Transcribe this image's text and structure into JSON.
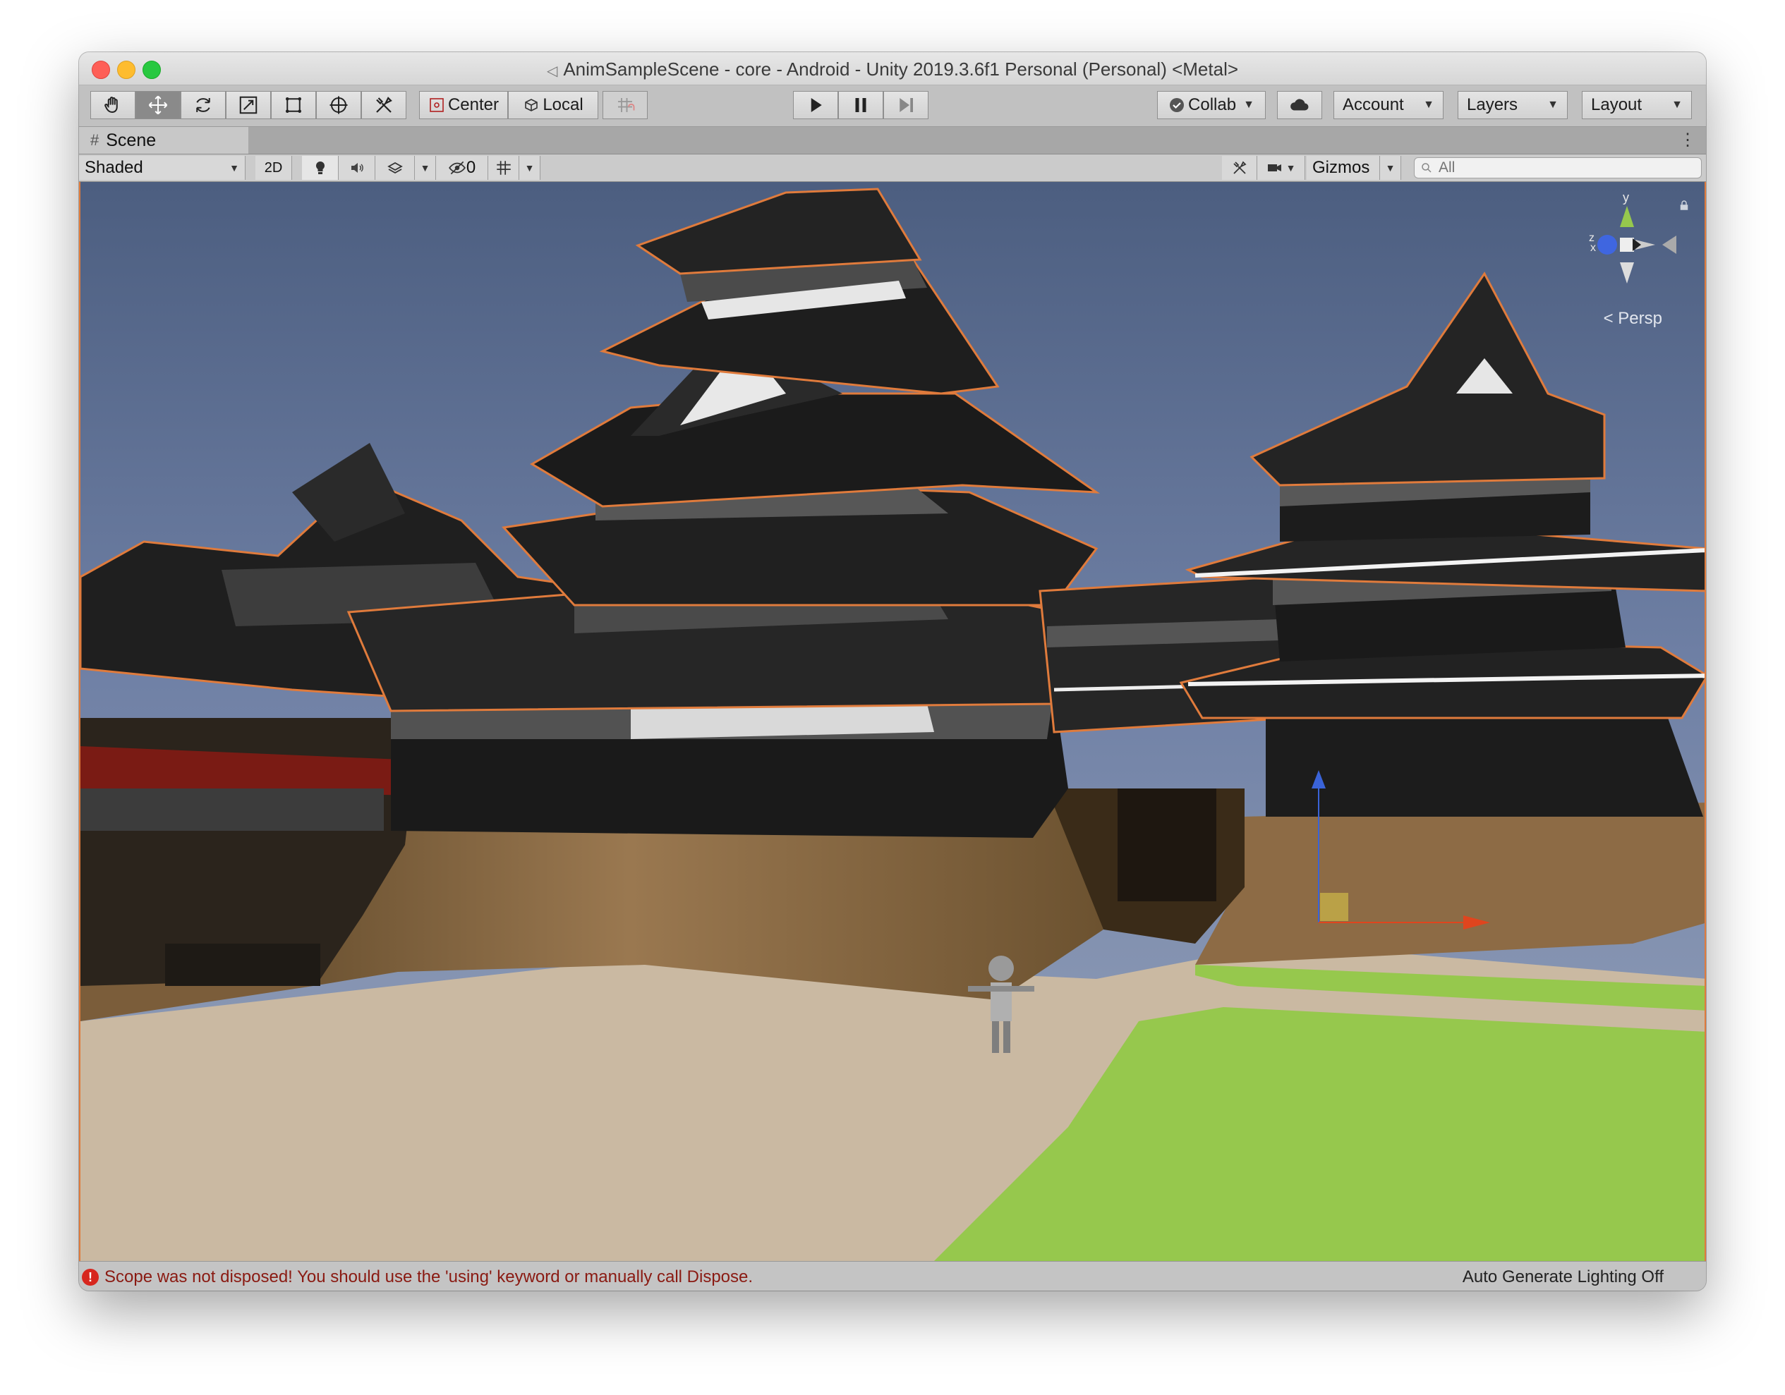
{
  "window": {
    "title": "AnimSampleScene - core - Android - Unity 2019.3.6f1 Personal (Personal) <Metal>"
  },
  "toolbar": {
    "transform_tools": [
      "hand-tool",
      "move-tool",
      "rotate-tool",
      "scale-tool",
      "rect-tool",
      "transform-tool",
      "custom-tool"
    ],
    "pivot_label": "Center",
    "space_label": "Local",
    "collab_label": "Collab",
    "account_label": "Account",
    "layers_label": "Layers",
    "layout_label": "Layout"
  },
  "scene_tab": {
    "label": "Scene"
  },
  "scene_toolbar": {
    "draw_mode": "Shaded",
    "mode_2d": "2D",
    "hidden_count": "0",
    "gizmos_label": "Gizmos",
    "search_placeholder": "All"
  },
  "viewport": {
    "gizmo_axes": {
      "y": "y",
      "z": "z",
      "x": "x"
    },
    "projection_label": "< Persp"
  },
  "status": {
    "error_message": "Scope was not disposed! You should use the 'using' keyword or manually call Dispose.",
    "lighting": "Auto Generate Lighting Off"
  },
  "colors": {
    "selection_outline": "#e07b3c",
    "sky_top": "#4c5e80",
    "ground": "#cab9a2",
    "grass": "#96c84d",
    "wall": "#8d6b45"
  }
}
